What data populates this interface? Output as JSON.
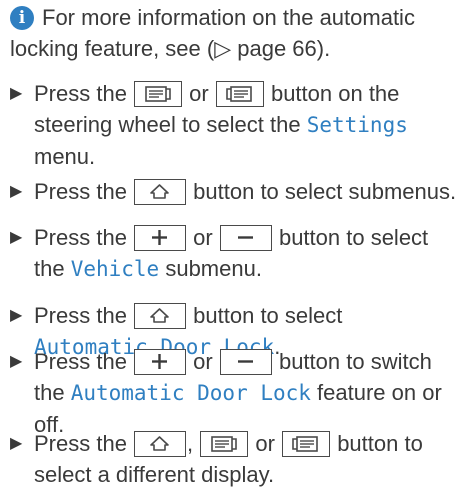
{
  "info": {
    "icon": "info-icon",
    "text": "For more information on the automatic locking feature, see (▷ page 66)."
  },
  "steps": [
    {
      "bullet": "▶",
      "p1": "Press the ",
      "or": " or ",
      "p2": " button on the steering wheel to select the ",
      "code": "Settings",
      "p3": " menu."
    },
    {
      "bullet": "▶",
      "p1": "Press the ",
      "p2": " button to select submenus."
    },
    {
      "bullet": "▶",
      "p1": "Press the ",
      "or": " or ",
      "p2": " button to select the ",
      "code": "Vehicle",
      "p3": " submenu."
    },
    {
      "bullet": "▶",
      "p1": "Press the ",
      "p2": " button to select ",
      "code": "Automatic Door Lock",
      "p3": "."
    },
    {
      "bullet": "▶",
      "p1": "Press the ",
      "or": " or ",
      "p2": " button to switch the ",
      "code": "Automatic Door Lock",
      "p3": " feature on or off."
    },
    {
      "bullet": "▶",
      "p1": "Press the ",
      "comma": ", ",
      "or": " or ",
      "p2": " button to select a different display."
    }
  ],
  "icons": {
    "page_back": "page-back-button-icon",
    "page_forward": "page-forward-button-icon",
    "home": "home-button-icon",
    "plus": "plus-button-icon",
    "minus": "minus-button-icon"
  },
  "colors": {
    "accent": "#2f7fc1",
    "text": "#3a3a3a"
  }
}
